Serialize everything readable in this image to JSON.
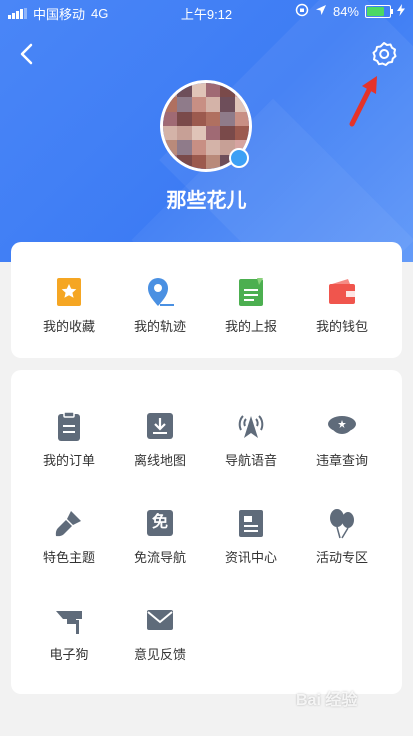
{
  "status_bar": {
    "carrier": "中国移动",
    "network": "4G",
    "time": "上午9:12",
    "battery": "84%",
    "battery_level": 0.84
  },
  "profile": {
    "nickname": "那些花儿"
  },
  "quick_actions": [
    {
      "label": "我的收藏",
      "icon": "star-bookmark-icon",
      "color": "#f5a623"
    },
    {
      "label": "我的轨迹",
      "icon": "location-pin-icon",
      "color": "#4a90e2"
    },
    {
      "label": "我的上报",
      "icon": "report-document-icon",
      "color": "#4caf50"
    },
    {
      "label": "我的钱包",
      "icon": "wallet-icon",
      "color": "#f0554d"
    }
  ],
  "menu": [
    {
      "label": "我的订单",
      "icon": "clipboard-icon"
    },
    {
      "label": "离线地图",
      "icon": "download-icon"
    },
    {
      "label": "导航语音",
      "icon": "navigation-sound-icon"
    },
    {
      "label": "违章查询",
      "icon": "police-cap-icon"
    },
    {
      "label": "特色主题",
      "icon": "paint-brush-icon"
    },
    {
      "label": "免流导航",
      "icon": "free-data-icon",
      "glyph": "免"
    },
    {
      "label": "资讯中心",
      "icon": "news-icon"
    },
    {
      "label": "活动专区",
      "icon": "balloons-icon"
    },
    {
      "label": "电子狗",
      "icon": "speed-camera-icon"
    },
    {
      "label": "意见反馈",
      "icon": "envelope-icon"
    }
  ],
  "watermark": "Bai 经验"
}
